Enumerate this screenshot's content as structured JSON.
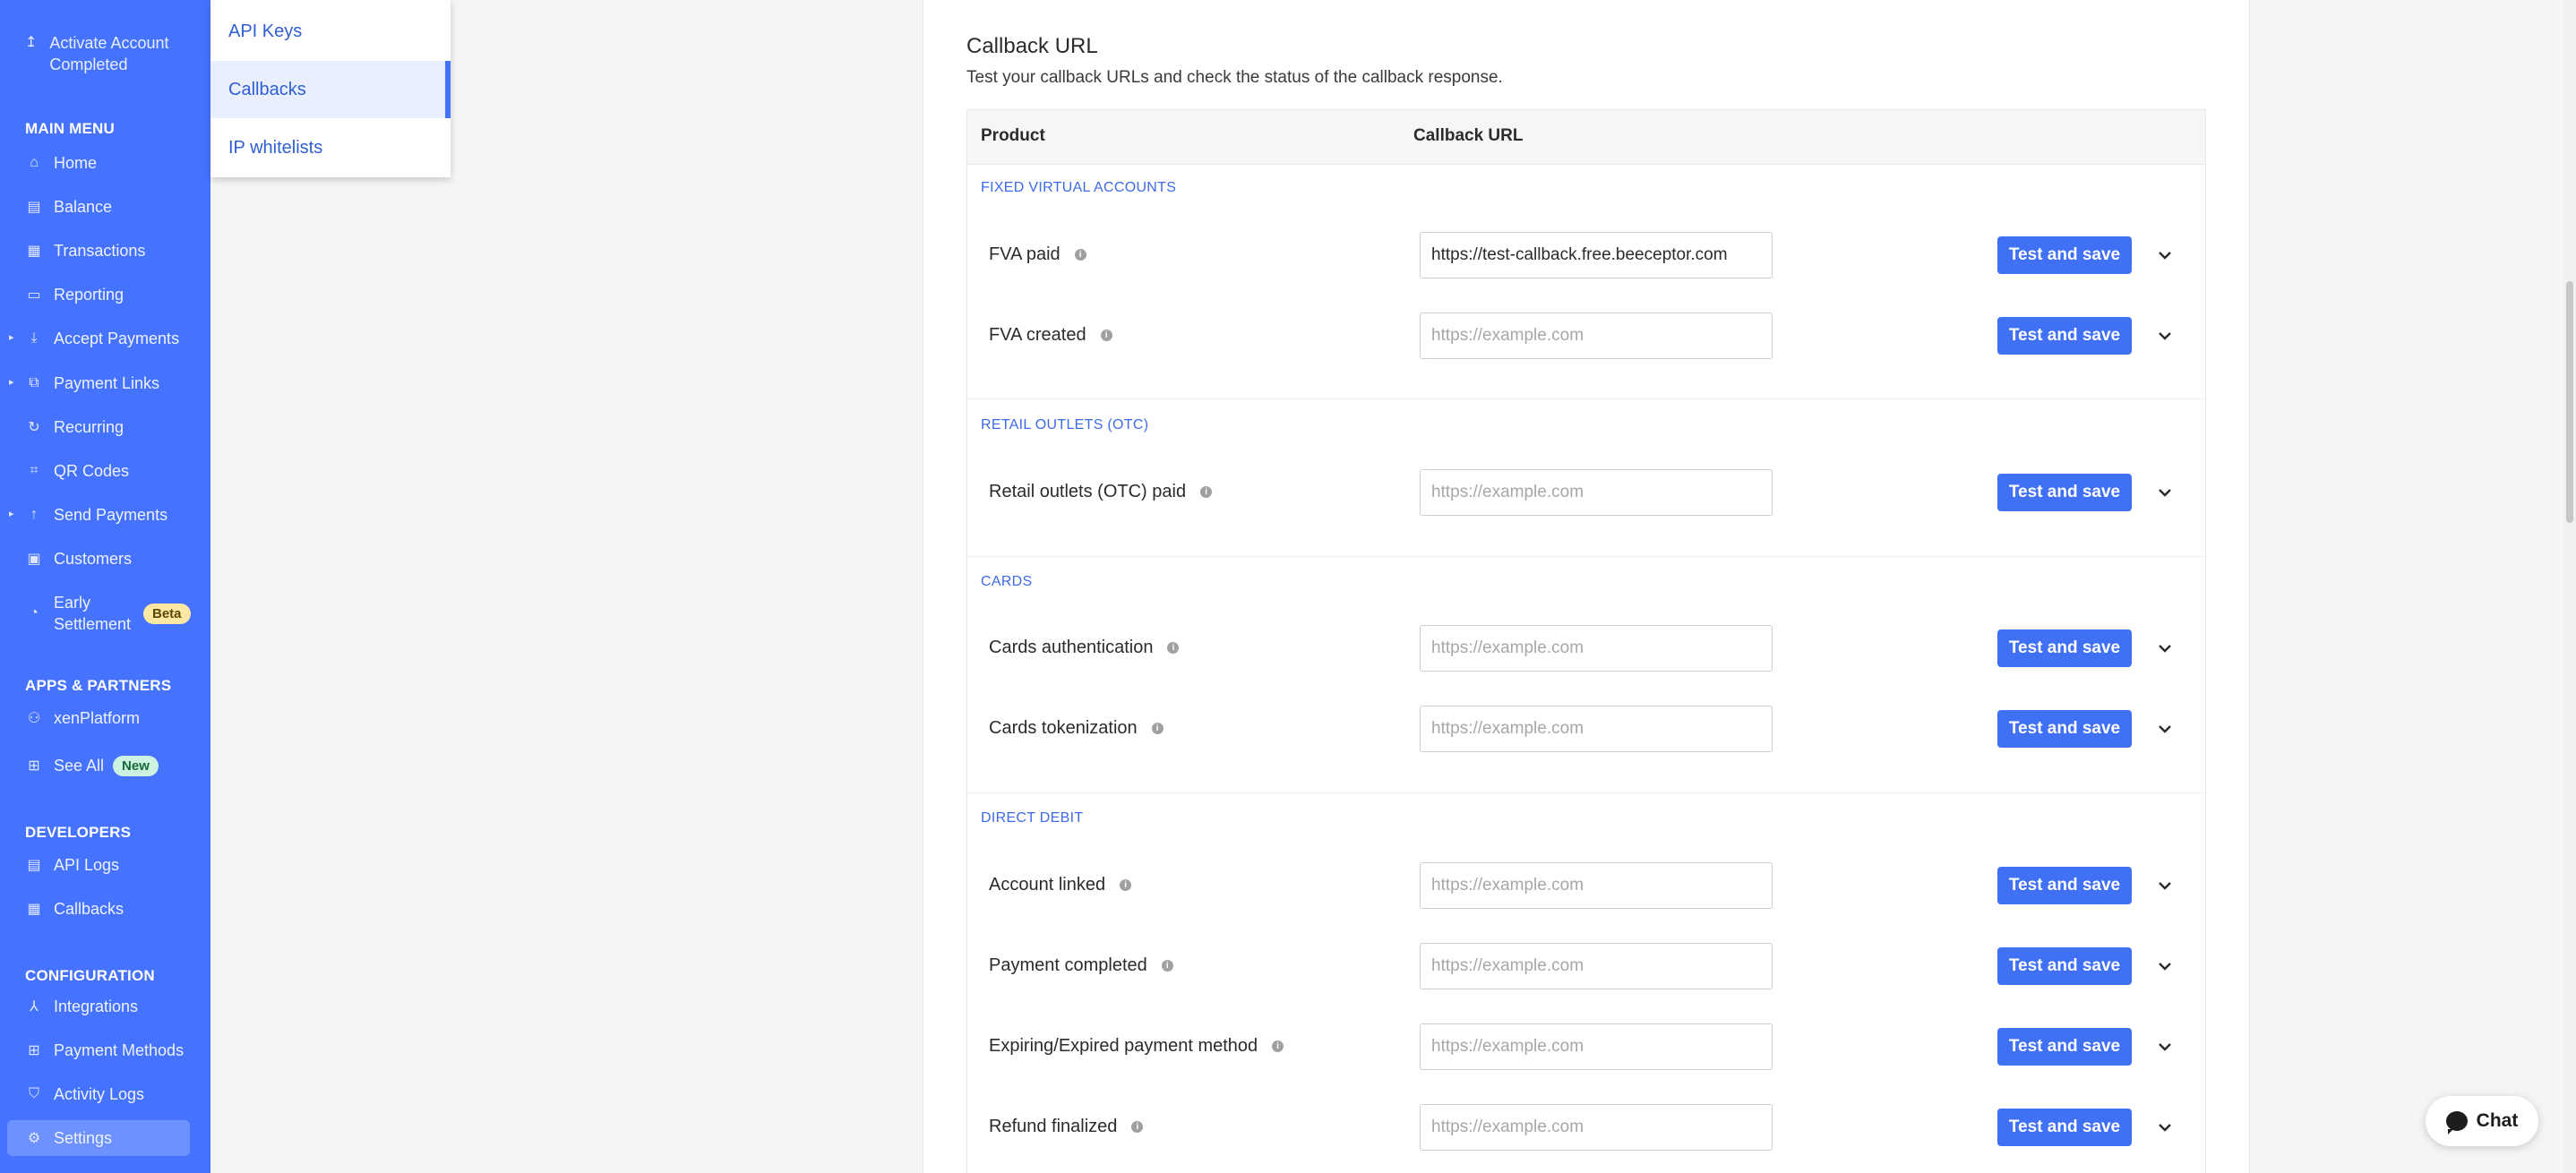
{
  "sidebar": {
    "activate": "Activate Account Completed",
    "main_menu_title": "MAIN MENU",
    "main_menu": [
      {
        "label": "Home",
        "icon": "home-icon"
      },
      {
        "label": "Balance",
        "icon": "balance-icon"
      },
      {
        "label": "Transactions",
        "icon": "transactions-icon"
      },
      {
        "label": "Reporting",
        "icon": "reporting-icon"
      },
      {
        "label": "Accept Payments",
        "icon": "accept-payments-icon"
      },
      {
        "label": "Payment Links",
        "icon": "payment-links-icon"
      },
      {
        "label": "Recurring",
        "icon": "recurring-icon"
      },
      {
        "label": "QR Codes",
        "icon": "qr-code-icon"
      },
      {
        "label": "Send Payments",
        "icon": "send-payments-icon"
      },
      {
        "label": "Customers",
        "icon": "customers-icon"
      },
      {
        "label": "Early Settlement",
        "icon": "early-settlement-icon",
        "badge": "Beta"
      }
    ],
    "apps_title": "APPS & PARTNERS",
    "apps": [
      {
        "label": "xenPlatform",
        "icon": "xenplatform-icon"
      },
      {
        "label": "See All",
        "icon": "see-all-icon",
        "badge": "New"
      }
    ],
    "developers_title": "DEVELOPERS",
    "developers": [
      {
        "label": "API Logs",
        "icon": "api-logs-icon"
      },
      {
        "label": "Callbacks",
        "icon": "callbacks-icon"
      }
    ],
    "configuration_title": "CONFIGURATION",
    "configuration": [
      {
        "label": "Integrations",
        "icon": "integrations-icon"
      },
      {
        "label": "Payment Methods",
        "icon": "payment-methods-icon"
      },
      {
        "label": "Activity Logs",
        "icon": "activity-logs-icon"
      },
      {
        "label": "Settings",
        "icon": "settings-icon"
      }
    ]
  },
  "submenu": {
    "items": [
      "API Keys",
      "Callbacks",
      "IP whitelists"
    ],
    "active": "Callbacks"
  },
  "main": {
    "title": "Callback URL",
    "subtitle": "Test your callback URLs and check the status of the callback response.",
    "columns": [
      "Product",
      "Callback URL"
    ],
    "button_label": "Test and save",
    "placeholder": "https://example.com",
    "groups": [
      {
        "title": "FIXED VIRTUAL ACCOUNTS",
        "rows": [
          {
            "label": "FVA paid",
            "value": "https://test-callback.free.beeceptor.com"
          },
          {
            "label": "FVA created",
            "value": ""
          }
        ]
      },
      {
        "title": "RETAIL OUTLETS (OTC)",
        "rows": [
          {
            "label": "Retail outlets (OTC) paid",
            "value": ""
          }
        ]
      },
      {
        "title": "CARDS",
        "rows": [
          {
            "label": "Cards authentication",
            "value": ""
          },
          {
            "label": "Cards tokenization",
            "value": ""
          }
        ]
      },
      {
        "title": "DIRECT DEBIT",
        "rows": [
          {
            "label": "Account linked",
            "value": ""
          },
          {
            "label": "Payment completed",
            "value": ""
          },
          {
            "label": "Expiring/Expired payment method",
            "value": ""
          },
          {
            "label": "Refund finalized",
            "value": ""
          }
        ]
      }
    ]
  },
  "chat": {
    "label": "Chat"
  },
  "colors": {
    "brand": "#4573ff",
    "button": "#4070f4",
    "link": "#2f5fd0"
  }
}
